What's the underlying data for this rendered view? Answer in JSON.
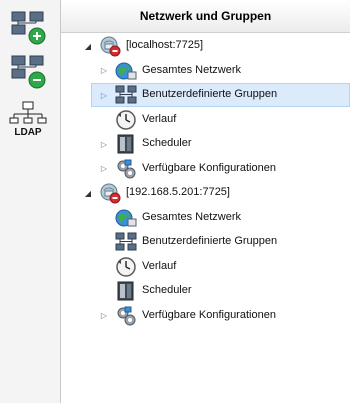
{
  "panel": {
    "title": "Netzwerk und Gruppen"
  },
  "toolbar": {
    "buttons": [
      {
        "icon": "add-network-icon"
      },
      {
        "icon": "remove-network-icon"
      },
      {
        "icon": "ldap-icon",
        "label": "LDAP"
      }
    ]
  },
  "tree": [
    {
      "label": "[localhost:7725]",
      "icon": "server-error-icon",
      "level": 0,
      "expander": "open"
    },
    {
      "label": "Gesamtes Netzwerk",
      "icon": "globe-network-icon",
      "level": 1,
      "expander": "closed"
    },
    {
      "label": "Benutzerdefinierte Gruppen",
      "icon": "groups-icon",
      "level": 1,
      "expander": "closed",
      "selected": true
    },
    {
      "label": "Verlauf",
      "icon": "clock-icon",
      "level": 1,
      "expander": "none"
    },
    {
      "label": "Scheduler",
      "icon": "scheduler-icon",
      "level": 1,
      "expander": "closed"
    },
    {
      "label": "Verfügbare Konfigurationen",
      "icon": "configurations-icon",
      "level": 1,
      "expander": "closed"
    },
    {
      "label": "[192.168.5.201:7725]",
      "icon": "server-error-icon",
      "level": 0,
      "expander": "open"
    },
    {
      "label": "Gesamtes Netzwerk",
      "icon": "globe-network-icon",
      "level": 1,
      "expander": "none"
    },
    {
      "label": "Benutzerdefinierte Gruppen",
      "icon": "groups-icon",
      "level": 1,
      "expander": "none"
    },
    {
      "label": "Verlauf",
      "icon": "clock-icon",
      "level": 1,
      "expander": "none"
    },
    {
      "label": "Scheduler",
      "icon": "scheduler-icon",
      "level": 1,
      "expander": "none"
    },
    {
      "label": "Verfügbare Konfigurationen",
      "icon": "configurations-icon",
      "level": 1,
      "expander": "closed"
    }
  ]
}
